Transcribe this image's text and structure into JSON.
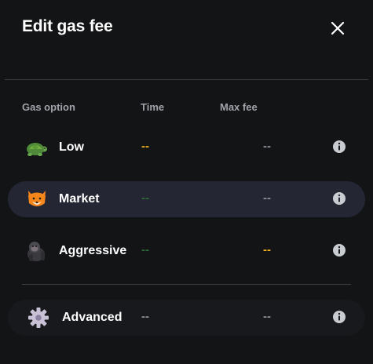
{
  "header": {
    "title": "Edit gas fee"
  },
  "columns": {
    "option": "Gas option",
    "time": "Time",
    "max_fee": "Max fee"
  },
  "options": [
    {
      "label": "Low",
      "icon": "turtle-icon",
      "time": "--",
      "max_fee": "--",
      "time_color": "#f2b21b",
      "fee_color": "#8e9198"
    },
    {
      "label": "Market",
      "icon": "fox-icon",
      "time": "--",
      "max_fee": "--",
      "time_color": "#2e6b3a",
      "fee_color": "#8e9198",
      "selected": true
    },
    {
      "label": "Aggressive",
      "icon": "gorilla-icon",
      "time": "--",
      "max_fee": "--",
      "time_color": "#2e6b3a",
      "fee_color": "#f2b21b"
    }
  ],
  "advanced": {
    "label": "Advanced",
    "icon": "gear-icon",
    "time": "--",
    "max_fee": "--"
  },
  "colors": {
    "background": "#131416",
    "selected_row": "#242733",
    "warning": "#f2b21b",
    "success": "#2e6b3a"
  }
}
